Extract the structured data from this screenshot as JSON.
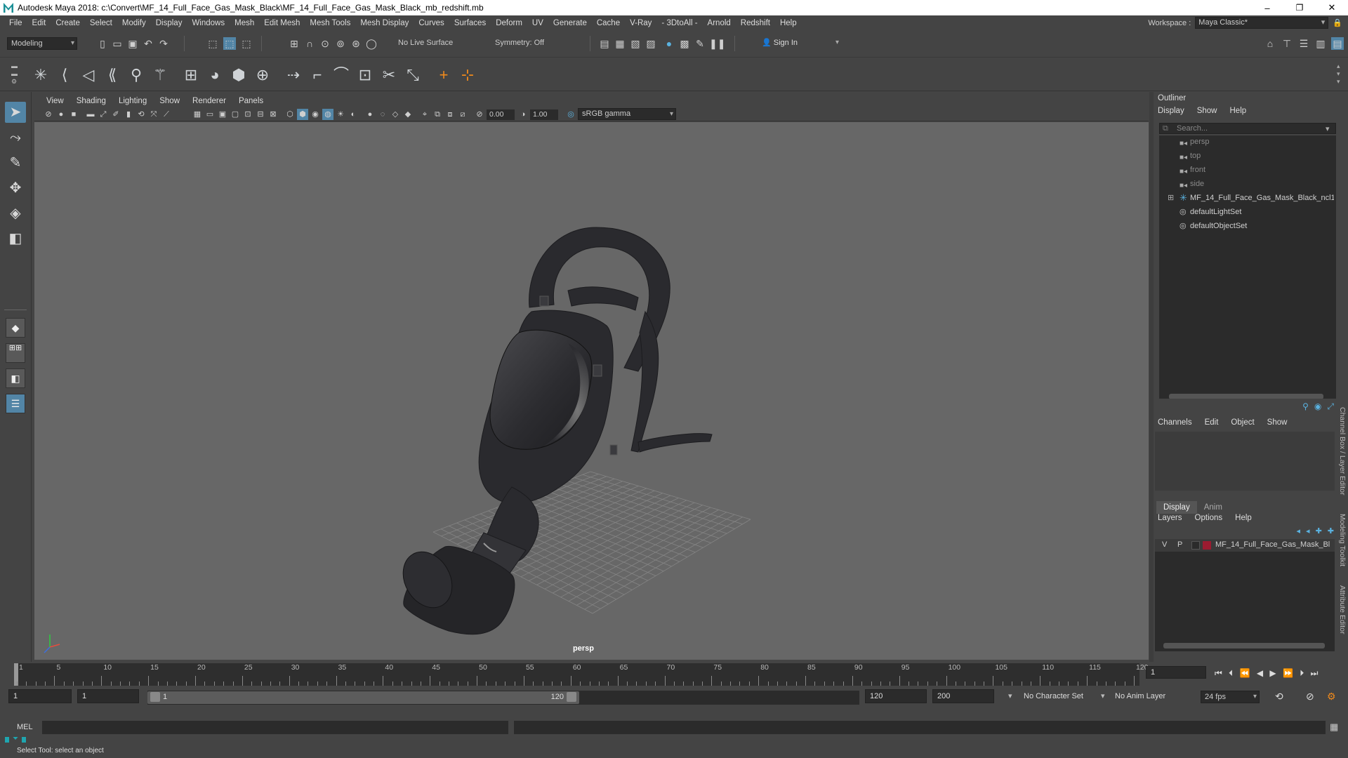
{
  "window": {
    "title": "Autodesk Maya 2018: c:\\Convert\\MF_14_Full_Face_Gas_Mask_Black\\MF_14_Full_Face_Gas_Mask_Black_mb_redshift.mb",
    "minimize": "–",
    "maximize": "❐",
    "close": "✕"
  },
  "menu": [
    "File",
    "Edit",
    "Create",
    "Select",
    "Modify",
    "Display",
    "Windows",
    "Mesh",
    "Edit Mesh",
    "Mesh Tools",
    "Mesh Display",
    "Curves",
    "Surfaces",
    "Deform",
    "UV",
    "Generate",
    "Cache",
    "V-Ray",
    "- 3DtoAll -",
    "Arnold",
    "Redshift",
    "Help"
  ],
  "workspace": {
    "label": "Workspace :",
    "value": "Maya Classic*"
  },
  "statusline": {
    "mode": "Modeling",
    "live_surface": "No Live Surface",
    "symmetry": "Symmetry: Off",
    "sign_in": "Sign In"
  },
  "viewport": {
    "menu": [
      "View",
      "Shading",
      "Lighting",
      "Show",
      "Renderer",
      "Panels"
    ],
    "exposure": "0.00",
    "gamma": "1.00",
    "color_space": "sRGB gamma",
    "camera_label": "persp",
    "colors": {
      "background": "#676767",
      "grid": "#8a8a8a",
      "mask": "#2a2a2d"
    }
  },
  "outliner": {
    "title": "Outliner",
    "menu": [
      "Display",
      "Show",
      "Help"
    ],
    "search_placeholder": "Search...",
    "items": [
      {
        "label": "persp",
        "icon": "camera-icon",
        "dim": true
      },
      {
        "label": "top",
        "icon": "camera-icon",
        "dim": true
      },
      {
        "label": "front",
        "icon": "camera-icon",
        "dim": true
      },
      {
        "label": "side",
        "icon": "camera-icon",
        "dim": true
      },
      {
        "label": "MF_14_Full_Face_Gas_Mask_Black_ncl1_",
        "icon": "group-icon",
        "dim": false,
        "expandable": true
      },
      {
        "label": "defaultLightSet",
        "icon": "set-icon",
        "dim": false
      },
      {
        "label": "defaultObjectSet",
        "icon": "set-icon",
        "dim": false
      }
    ]
  },
  "channelbox": {
    "menu": [
      "Channels",
      "Edit",
      "Object",
      "Show"
    ],
    "side_tabs": "Channel Box / Layer Editor",
    "side_tabs2": "Modeling Toolkit",
    "side_tabs3": "Attribute Editor"
  },
  "layers": {
    "tabs": [
      "Display",
      "Anim"
    ],
    "active_tab": "Display",
    "menu": [
      "Layers",
      "Options",
      "Help"
    ],
    "layer": {
      "v": "V",
      "p": "P",
      "name": "MF_14_Full_Face_Gas_Mask_Bl",
      "color": "#9b1b30"
    }
  },
  "timeline": {
    "ticks": [
      "1",
      "5",
      "10",
      "15",
      "20",
      "25",
      "30",
      "35",
      "40",
      "45",
      "50",
      "55",
      "60",
      "65",
      "70",
      "75",
      "80",
      "85",
      "90",
      "95",
      "100",
      "105",
      "110",
      "115",
      "120"
    ],
    "current_frame": "1"
  },
  "range": {
    "start": "1",
    "playback_start": "1",
    "slider_start": "1",
    "slider_end": "120",
    "playback_end": "120",
    "end": "200",
    "character_set": "No Character Set",
    "anim_layer": "No Anim Layer",
    "fps": "24 fps"
  },
  "command": {
    "lang": "MEL"
  },
  "help_line": "Select Tool: select an object"
}
